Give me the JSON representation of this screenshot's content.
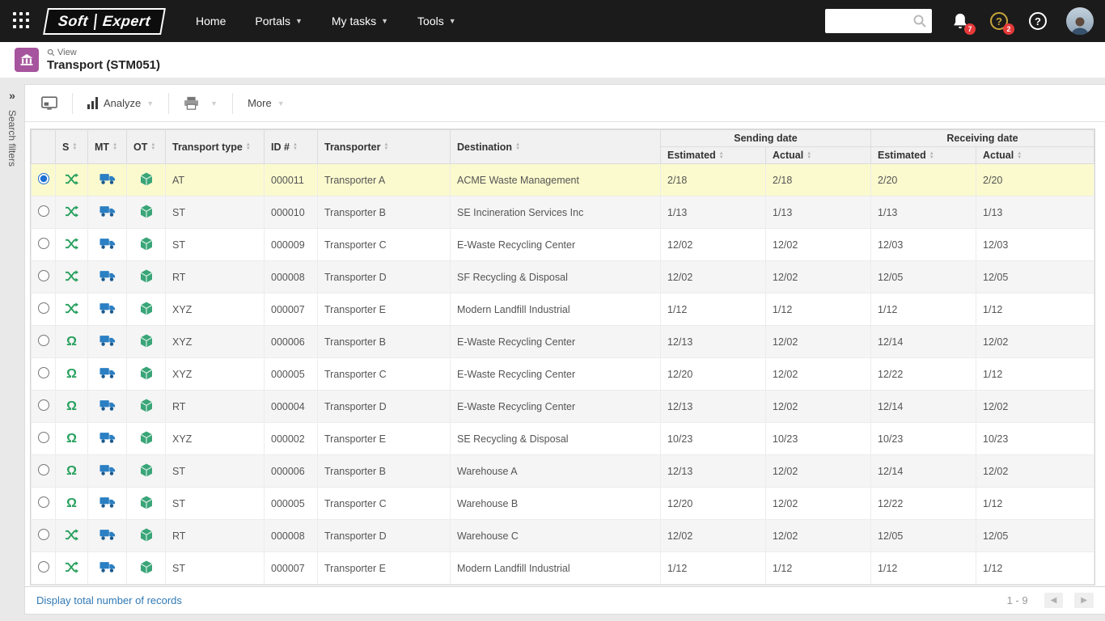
{
  "topbar": {
    "logo": {
      "soft": "Soft",
      "expert": "Expert"
    },
    "nav": [
      {
        "label": "Home",
        "dropdown": false
      },
      {
        "label": "Portals",
        "dropdown": true
      },
      {
        "label": "My tasks",
        "dropdown": true
      },
      {
        "label": "Tools",
        "dropdown": true
      }
    ],
    "search": {
      "placeholder": ""
    },
    "badges": {
      "notifications": "7",
      "activities": "2"
    }
  },
  "header": {
    "view_label": "View",
    "title": "Transport (STM051)"
  },
  "sidebar": {
    "collapse_glyph": "»",
    "filters_label": "Search filters"
  },
  "toolbar": {
    "analyze_label": "Analyze",
    "more_label": "More"
  },
  "table": {
    "columns": {
      "s": "S",
      "mt": "MT",
      "ot": "OT",
      "transport_type": "Transport type",
      "id": "ID #",
      "transporter": "Transporter",
      "destination": "Destination"
    },
    "groups": {
      "sending": "Sending date",
      "receiving": "Receiving date"
    },
    "sub_columns": {
      "estimated": "Estimated",
      "actual": "Actual"
    },
    "rows": [
      {
        "selected": true,
        "status": "transit",
        "transport_type": "AT",
        "id": "000011",
        "transporter": "Transporter A",
        "destination": "ACME Waste Management",
        "sending_estimated": "2/18",
        "sending_actual": "2/18",
        "receiving_estimated": "2/20",
        "receiving_actual": "2/20"
      },
      {
        "selected": false,
        "status": "transit",
        "transport_type": "ST",
        "id": "000010",
        "transporter": "Transporter B",
        "destination": "SE Incineration Services Inc",
        "sending_estimated": "1/13",
        "sending_actual": "1/13",
        "receiving_estimated": "1/13",
        "receiving_actual": "1/13"
      },
      {
        "selected": false,
        "status": "transit",
        "transport_type": "ST",
        "id": "000009",
        "transporter": "Transporter C",
        "destination": "E-Waste Recycling Center",
        "sending_estimated": "12/02",
        "sending_actual": "12/02",
        "receiving_estimated": "12/03",
        "receiving_actual": "12/03"
      },
      {
        "selected": false,
        "status": "transit",
        "transport_type": "RT",
        "id": "000008",
        "transporter": "Transporter D",
        "destination": "SF Recycling & Disposal",
        "sending_estimated": "12/02",
        "sending_actual": "12/02",
        "receiving_estimated": "12/05",
        "receiving_actual": "12/05"
      },
      {
        "selected": false,
        "status": "transit",
        "transport_type": "XYZ",
        "id": "000007",
        "transporter": "Transporter E",
        "destination": "Modern Landfill Industrial",
        "sending_estimated": "1/12",
        "sending_actual": "1/12",
        "receiving_estimated": "1/12",
        "receiving_actual": "1/12"
      },
      {
        "selected": false,
        "status": "return",
        "transport_type": "XYZ",
        "id": "000006",
        "transporter": "Transporter B",
        "destination": "E-Waste Recycling Center",
        "sending_estimated": "12/13",
        "sending_actual": "12/02",
        "receiving_estimated": "12/14",
        "receiving_actual": "12/02"
      },
      {
        "selected": false,
        "status": "return",
        "transport_type": "XYZ",
        "id": "000005",
        "transporter": "Transporter C",
        "destination": "E-Waste Recycling Center",
        "sending_estimated": "12/20",
        "sending_actual": "12/02",
        "receiving_estimated": "12/22",
        "receiving_actual": "1/12"
      },
      {
        "selected": false,
        "status": "return",
        "transport_type": "RT",
        "id": "000004",
        "transporter": "Transporter D",
        "destination": "E-Waste Recycling Center",
        "sending_estimated": "12/13",
        "sending_actual": "12/02",
        "receiving_estimated": "12/14",
        "receiving_actual": "12/02"
      },
      {
        "selected": false,
        "status": "return",
        "transport_type": "XYZ",
        "id": "000002",
        "transporter": "Transporter E",
        "destination": "SE Recycling & Disposal",
        "sending_estimated": "10/23",
        "sending_actual": "10/23",
        "receiving_estimated": "10/23",
        "receiving_actual": "10/23"
      },
      {
        "selected": false,
        "status": "return",
        "transport_type": "ST",
        "id": "000006",
        "transporter": "Transporter B",
        "destination": "Warehouse A",
        "sending_estimated": "12/13",
        "sending_actual": "12/02",
        "receiving_estimated": "12/14",
        "receiving_actual": "12/02"
      },
      {
        "selected": false,
        "status": "return",
        "transport_type": "ST",
        "id": "000005",
        "transporter": "Transporter C",
        "destination": "Warehouse B",
        "sending_estimated": "12/20",
        "sending_actual": "12/02",
        "receiving_estimated": "12/22",
        "receiving_actual": "1/12"
      },
      {
        "selected": false,
        "status": "transit",
        "transport_type": "RT",
        "id": "000008",
        "transporter": "Transporter D",
        "destination": "Warehouse C",
        "sending_estimated": "12/02",
        "sending_actual": "12/02",
        "receiving_estimated": "12/05",
        "receiving_actual": "12/05"
      },
      {
        "selected": false,
        "status": "transit",
        "transport_type": "ST",
        "id": "000007",
        "transporter": "Transporter E",
        "destination": "Modern Landfill Industrial",
        "sending_estimated": "1/12",
        "sending_actual": "1/12",
        "receiving_estimated": "1/12",
        "receiving_actual": "1/12"
      }
    ]
  },
  "footer": {
    "total_records_link": "Display total number of records",
    "page_range": "1 - 9"
  },
  "colors": {
    "topbar_bg": "#1b1b1b",
    "accent_green": "#27a05d",
    "truck_blue": "#2b7fc3",
    "module_purple": "#a6549d",
    "link_blue": "#3179b5",
    "badge_red": "#e5393a",
    "selected_row": "#fbface"
  }
}
